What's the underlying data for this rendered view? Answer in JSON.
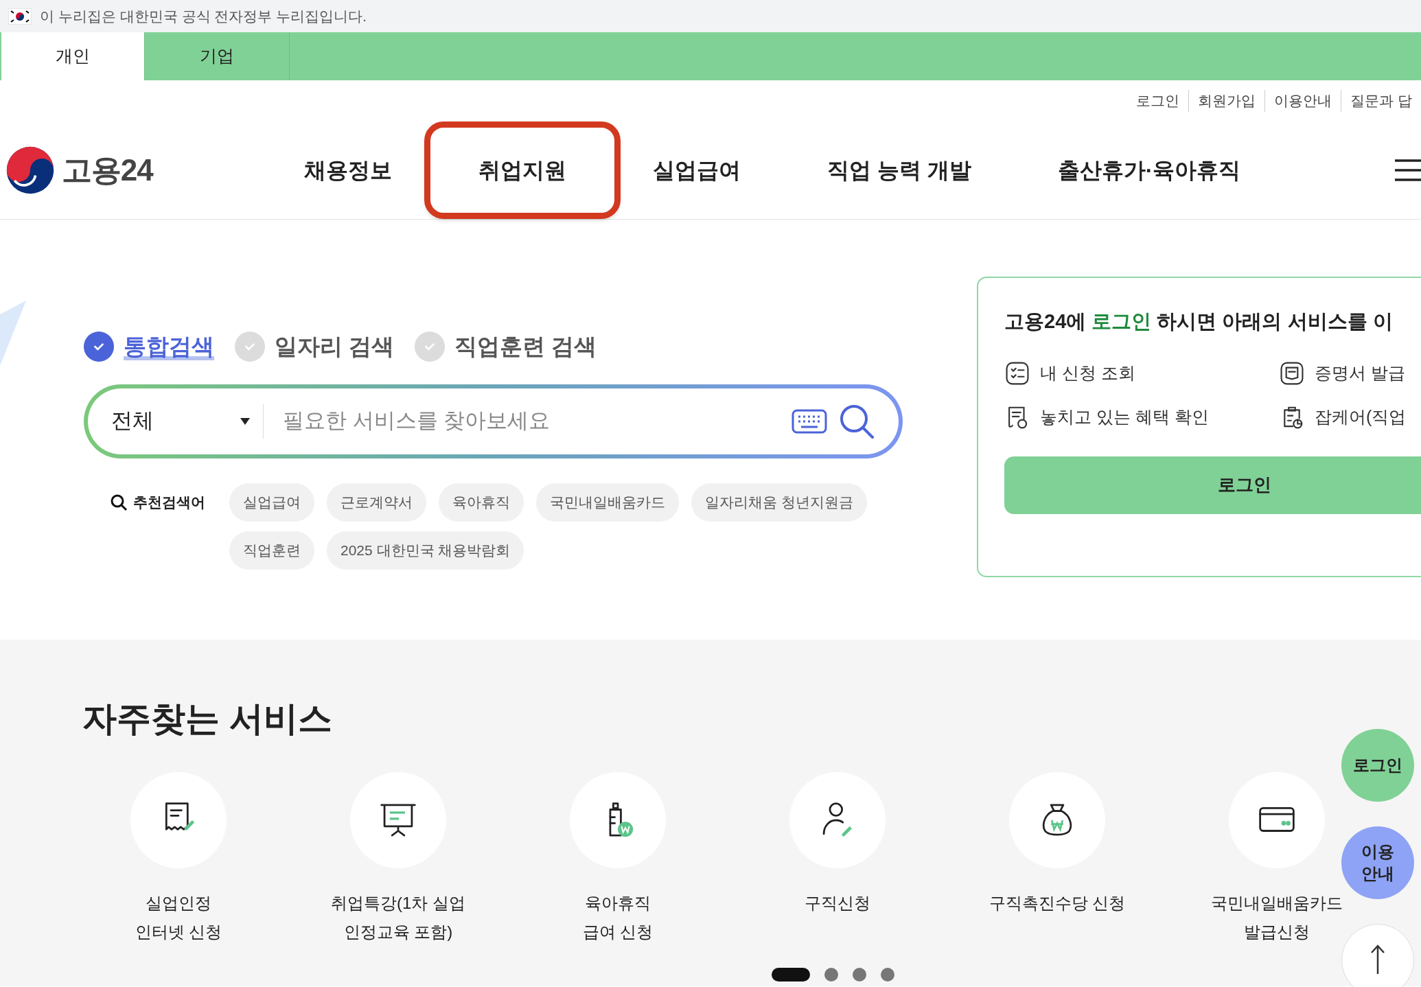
{
  "gov_banner": {
    "text": "이 누리집은 대한민국 공식 전자정부 누리집입니다."
  },
  "user_tabs": [
    {
      "label": "개인",
      "selected": true
    },
    {
      "label": "기업",
      "selected": false
    }
  ],
  "utility_links": [
    "로그인",
    "회원가입",
    "이용안내",
    "질문과 답"
  ],
  "logo": {
    "text": "고용24"
  },
  "nav": [
    {
      "label": "채용정보",
      "highlighted": false
    },
    {
      "label": "취업지원",
      "highlighted": true
    },
    {
      "label": "실업급여",
      "highlighted": false
    },
    {
      "label": "직업 능력 개발",
      "highlighted": false
    },
    {
      "label": "출산휴가·육아휴직",
      "highlighted": false
    }
  ],
  "search": {
    "tabs": [
      {
        "label": "통합검색",
        "selected": true
      },
      {
        "label": "일자리 검색",
        "selected": false
      },
      {
        "label": "직업훈련 검색",
        "selected": false
      }
    ],
    "scope": "전체",
    "placeholder": "필요한 서비스를 찾아보세요",
    "recommended_label": "추천검색어",
    "keywords": [
      "실업급여",
      "근로계약서",
      "육아휴직",
      "국민내일배움카드",
      "일자리채움 청년지원금",
      "직업훈련",
      "2025 대한민국 채용박람회"
    ]
  },
  "login_panel": {
    "message_prefix": "고용24에",
    "message_link": "로그인",
    "message_suffix": "하시면 아래의 서비스를 이",
    "services": [
      {
        "label": "내 신청 조회",
        "kind": "checklist"
      },
      {
        "label": "증명서 발급",
        "kind": "certificate"
      },
      {
        "label": "놓치고 있는 혜택 확인",
        "kind": "benefit"
      },
      {
        "label": "잡케어(직업",
        "kind": "jobcare"
      }
    ],
    "button": "로그인"
  },
  "frequent": {
    "title": "자주찾는 서비스",
    "items": [
      {
        "label": "실업인정\n인터넷 신청",
        "kind": "receipt"
      },
      {
        "label": "취업특강(1차 실업\n인정교육 포함)",
        "kind": "lecture"
      },
      {
        "label": "육아휴직\n급여 신청",
        "kind": "bottle"
      },
      {
        "label": "구직신청",
        "kind": "person"
      },
      {
        "label": "구직촉진수당 신청",
        "kind": "moneybag"
      },
      {
        "label": "국민내일배움카드\n발급신청",
        "kind": "card"
      }
    ]
  },
  "carousel_dots": [
    {
      "selected": true
    },
    {
      "selected": false
    },
    {
      "selected": false
    },
    {
      "selected": false
    }
  ],
  "floating": [
    {
      "label": "로그인",
      "kind": "login"
    },
    {
      "label": "이용\n안내",
      "kind": "guide"
    }
  ]
}
